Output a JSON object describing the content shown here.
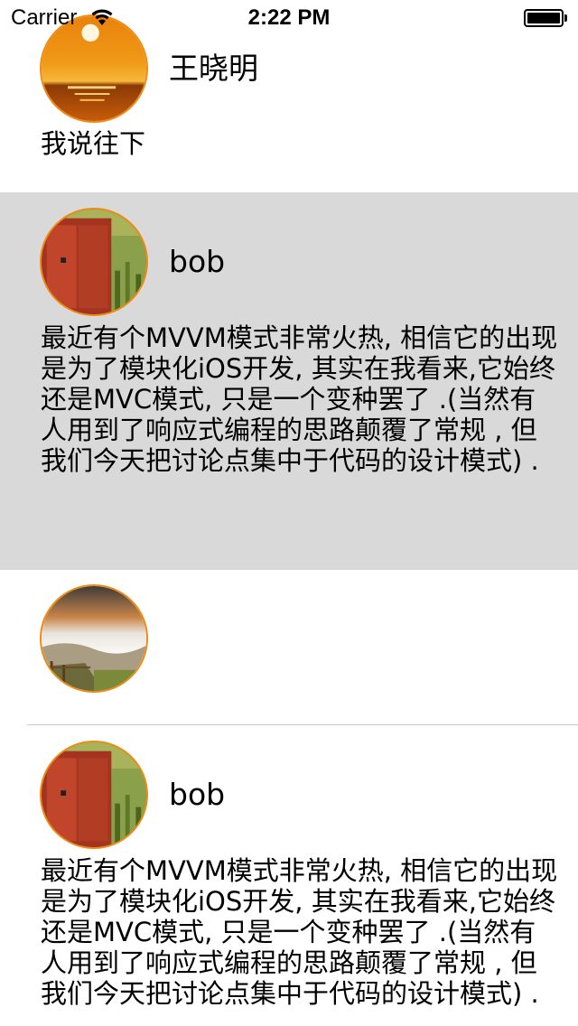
{
  "status_bar": {
    "carrier": "Carrier",
    "time": "2:22 PM"
  },
  "feed": [
    {
      "name": "王晓明",
      "text": "我说往下",
      "avatar": "sunset-avatar"
    },
    {
      "name": "bob",
      "text": "最近有个MVVM模式非常火热, 相信它的出现是为了模块化iOS开发, 其实在我看来,它始终还是MVC模式, 只是一个变种罢了 .(当然有人用到了响应式编程的思路颠覆了常规 , 但我们今天把讨论点集中于代码的设计模式) .",
      "avatar": "red-door-avatar"
    },
    {
      "name": "",
      "text": "",
      "avatar": "mountain-mist-avatar"
    },
    {
      "name": "bob",
      "text": "最近有个MVVM模式非常火热, 相信它的出现是为了模块化iOS开发, 其实在我看来,它始终还是MVC模式, 只是一个变种罢了 .(当然有人用到了响应式编程的思路颠覆了常规 , 但我们今天把讨论点集中于代码的设计模式) .",
      "avatar": "red-door-avatar"
    }
  ],
  "colors": {
    "avatar_border": "#f08a12",
    "selected_row": "#d9d9d9"
  }
}
